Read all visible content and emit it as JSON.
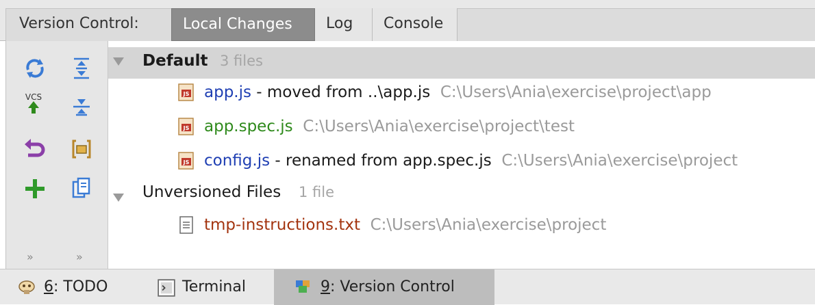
{
  "tool_window": {
    "title": "Version Control:",
    "tabs": [
      {
        "label": "Local Changes",
        "active": true
      },
      {
        "label": "Log",
        "active": false
      },
      {
        "label": "Console",
        "active": false
      }
    ]
  },
  "toolbar": {
    "buttons": [
      "refresh-icon",
      "expand-all-icon",
      "vcs-update-icon",
      "collapse-all-icon",
      "rollback-icon",
      "shelve-icon",
      "add-icon",
      "copy-icon"
    ],
    "vcs_text": "VCS",
    "more_left": "»",
    "more_right": "»"
  },
  "changelists": [
    {
      "name": "Default",
      "count": "3 files",
      "files": [
        {
          "name": "app.js",
          "note": " - moved from ..\\app.js",
          "path": "C:\\Users\\Ania\\exercise\\project\\app",
          "status": "modified"
        },
        {
          "name": "app.spec.js",
          "note": "",
          "path": "C:\\Users\\Ania\\exercise\\project\\test",
          "status": "added"
        },
        {
          "name": "config.js",
          "note": " - renamed from app.spec.js",
          "path": "C:\\Users\\Ania\\exercise\\project",
          "status": "modified"
        }
      ]
    },
    {
      "name": "Unversioned Files",
      "count": "1 file",
      "files": [
        {
          "name": "tmp-instructions.txt",
          "note": "",
          "path": "C:\\Users\\Ania\\exercise\\project",
          "status": "unversioned"
        }
      ]
    }
  ],
  "bottom_bar": {
    "todo": {
      "mnemonic": "6",
      "label": ": TODO"
    },
    "terminal": {
      "label": "Terminal"
    },
    "version_control": {
      "mnemonic": "9",
      "label": ": Version Control"
    }
  },
  "colors": {
    "modified": "#1f3fb3",
    "added": "#2f8a1c",
    "unversioned": "#a3340f",
    "path": "#9a9a9a"
  }
}
